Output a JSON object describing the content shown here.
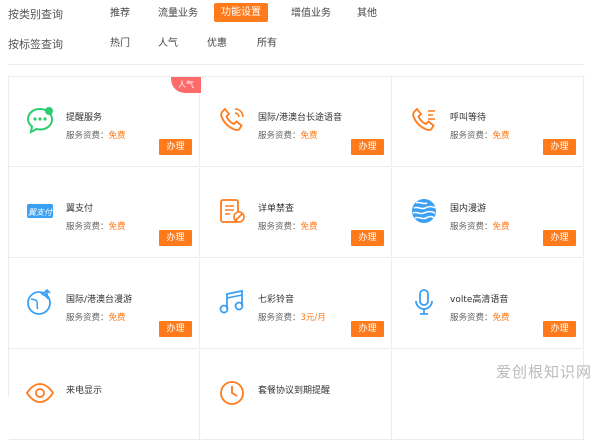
{
  "filters": {
    "category": {
      "label": "按类别查询",
      "options": [
        "推荐",
        "流量业务",
        "功能设置",
        "增值业务",
        "其他"
      ],
      "active_index": 2
    },
    "tag": {
      "label": "按标签查询",
      "options": [
        "热门",
        "人气",
        "优惠",
        "所有"
      ]
    }
  },
  "fee_label": "服务资费：",
  "button_label": "办理",
  "badge": "人气",
  "cards": [
    {
      "name": "提醒服务",
      "fee": "免费",
      "icon": "chat-bubble-icon"
    },
    {
      "name": "国际/港澳台长途语音",
      "fee": "免费",
      "icon": "phone-icon"
    },
    {
      "name": "呼叫等待",
      "fee": "免费",
      "icon": "phone-wait-icon"
    },
    {
      "name": "翼支付",
      "fee": "免费",
      "icon": "pay-icon"
    },
    {
      "name": "详单禁查",
      "fee": "免费",
      "icon": "doc-block-icon"
    },
    {
      "name": "国内漫游",
      "fee": "免费",
      "icon": "globe-stripes-icon"
    },
    {
      "name": "国际/港澳台漫游",
      "fee": "免费",
      "icon": "globe-roam-icon"
    },
    {
      "name": "七彩铃音",
      "fee": "3元/月",
      "icon": "music-note-icon"
    },
    {
      "name": "volte高清语音",
      "fee": "免费",
      "icon": "microphone-icon"
    },
    {
      "name": "来电显示",
      "fee": "",
      "icon": "eye-icon"
    },
    {
      "name": "套餐协议到期提醒",
      "fee": "",
      "icon": "clock-icon"
    }
  ],
  "watermark": "爱创根知识网",
  "colors": {
    "accent": "#ff7a1a",
    "icon_green": "#2ecc71",
    "icon_blue": "#3aa0f3",
    "icon_orange": "#ff7a1a",
    "badge": "#ff6b6b"
  }
}
